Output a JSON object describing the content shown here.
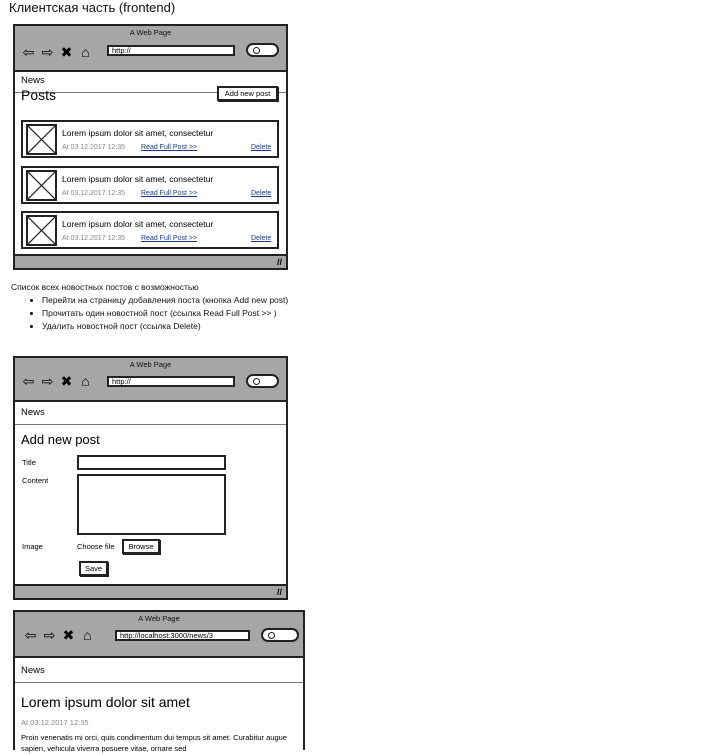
{
  "doc_title": "Клиентская часть (frontend)",
  "browser": {
    "page_title": "A Web Page",
    "url_default": "http://",
    "url_detail": "http://localhost:3000/news/3",
    "nav_label": "News"
  },
  "nav_icons": [
    "back-arrow-icon",
    "forward-arrow-icon",
    "close-x-icon",
    "home-icon"
  ],
  "list_page": {
    "heading": "Posts",
    "add_button": "Add new post",
    "posts": [
      {
        "title": "Lorem ipsum dolor sit amet, consectetur",
        "date": "At 03.12.2017 12:35",
        "read": "Read Full Post >>",
        "delete": "Delete"
      },
      {
        "title": "Lorem ipsum dolor sit amet, consectetur",
        "date": "At 03.12.2017 12:35",
        "read": "Read Full Post >>",
        "delete": "Delete"
      },
      {
        "title": "Lorem ipsum dolor sit amet, consectetur",
        "date": "At 03.12.2017 12:35",
        "read": "Read Full Post >>",
        "delete": "Delete"
      }
    ]
  },
  "description": {
    "intro": "Список всех новостных постов с возможностью",
    "items": [
      "Перейти на страницу добавления поста (кнопка Add new post)",
      "Прочитать один новостной пост (ссылка Read Full Post >> )",
      "Удалить новостной пост (ссылка Delete)"
    ]
  },
  "form_page": {
    "heading": "Add new post",
    "title_label": "Title",
    "content_label": "Content",
    "image_label": "Image",
    "choose_file": "Choose file",
    "browse_button": "Browse",
    "save_button": "Save"
  },
  "detail_page": {
    "heading": "Lorem ipsum dolor sit amet",
    "date": "At 03.12.2017 12:35",
    "body": "Proin venenatis mi orci, quis condimentum dui tempus sit amet. Curabitur augue sapien, vehicula viverra posuere vitae, ornare sed"
  }
}
